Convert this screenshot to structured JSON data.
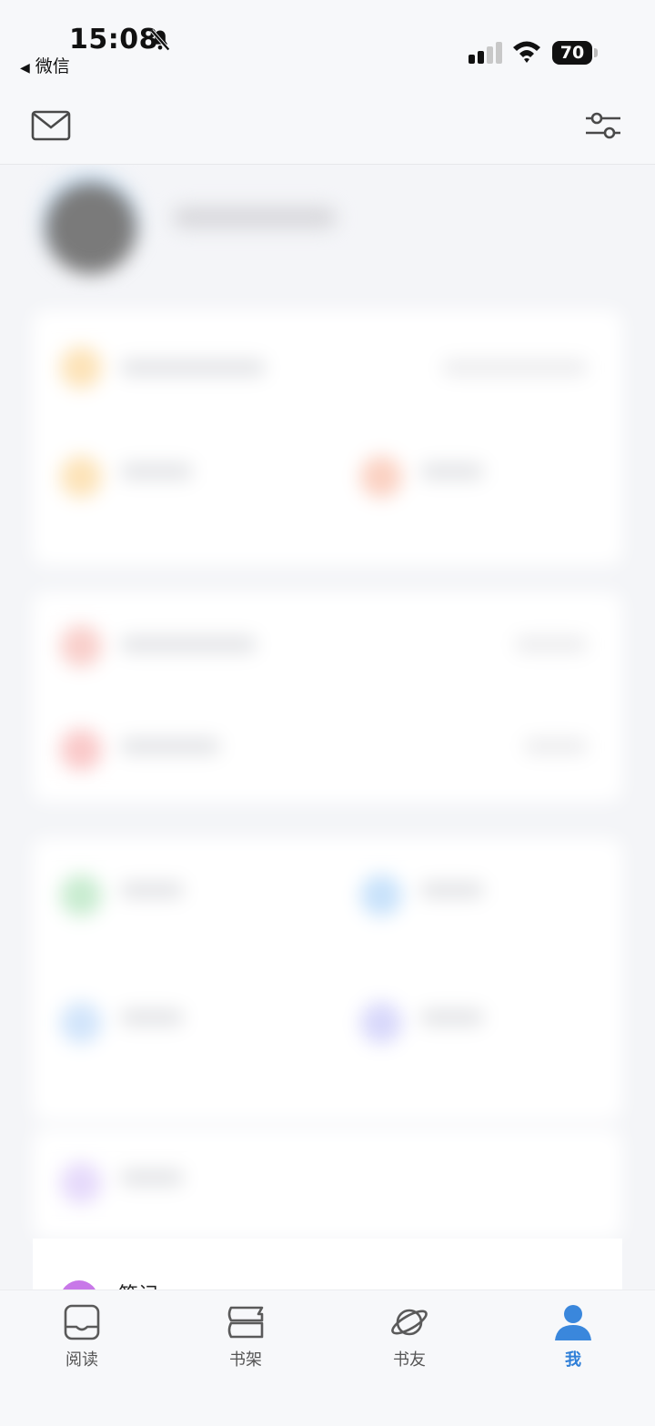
{
  "status_bar": {
    "time": "15:08",
    "back_app": "微信",
    "battery": "70"
  },
  "header": {
    "left_icon": "mail-icon",
    "right_icon": "filter-icon"
  },
  "content": {
    "partial_text": "笔记"
  },
  "tabbar": {
    "tabs": [
      {
        "label": "阅读",
        "icon": "book-icon"
      },
      {
        "label": "书架",
        "icon": "bookshelf-icon"
      },
      {
        "label": "书友",
        "icon": "planet-icon"
      },
      {
        "label": "我",
        "icon": "person-icon"
      }
    ],
    "active_index": 3,
    "active_color": "#2f7fd8"
  }
}
